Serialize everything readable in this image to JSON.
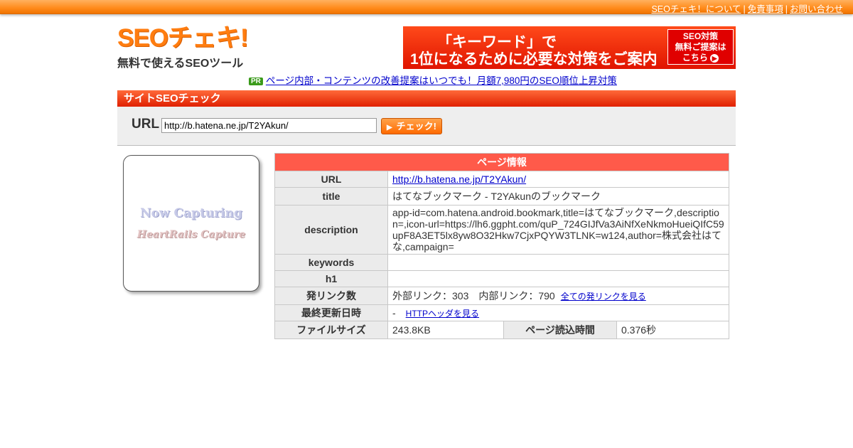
{
  "topbar": {
    "links": [
      "SEOチェキ！について",
      "免責事項",
      "お問い合わせ"
    ],
    "separator": "|"
  },
  "logo": {
    "title": "SEOチェキ!",
    "subtitle": "無料で使えるSEOツール"
  },
  "banner": {
    "line1": "「キーワード」で",
    "line2": "1位になるために必要な対策をご案内",
    "box_line1": "SEO対策",
    "box_line2": "無料ご提案は",
    "box_line3": "こちら"
  },
  "pr": {
    "badge": "PR",
    "text": "ページ内部・コンテンツの改善提案はいつでも！月額7,980円のSEO順位上昇対策"
  },
  "check": {
    "section_title": "サイトSEOチェック",
    "url_label": "URL",
    "url_value": "http://b.hatena.ne.jp/T2YAkun/",
    "button_label": "チェック!"
  },
  "capture": {
    "line1": "Now Capturing",
    "line2": "HeartRails Capture"
  },
  "info": {
    "header": "ページ情報",
    "rows": {
      "url_label": "URL",
      "url_value": "http://b.hatena.ne.jp/T2YAkun/",
      "title_label": "title",
      "title_value": "はてなブックマーク - T2YAkunのブックマーク",
      "description_label": "description",
      "description_value": "app-id=com.hatena.android.bookmark,title=はてなブックマーク,description=,icon-url=https://lh6.ggpht.com/quP_724GIJfVa3AiNfXeNkmoHueiQIfC59upF8A3ET5lx8yw8O32Hkw7CjxPQYW3TLNK=w124,author=株式会社はてな,campaign=",
      "keywords_label": "keywords",
      "keywords_value": "",
      "h1_label": "h1",
      "h1_value": "",
      "links_label": "発リンク数",
      "links_value": "外部リンク：303　内部リンク：790",
      "links_link": "全ての発リンクを見る",
      "updated_label": "最終更新日時",
      "updated_value": "-",
      "updated_link": "HTTPヘッダを見る",
      "filesize_label": "ファイルサイズ",
      "filesize_value": "243.8KB",
      "loadtime_label": "ページ読込時間",
      "loadtime_value": "0.376秒"
    }
  }
}
